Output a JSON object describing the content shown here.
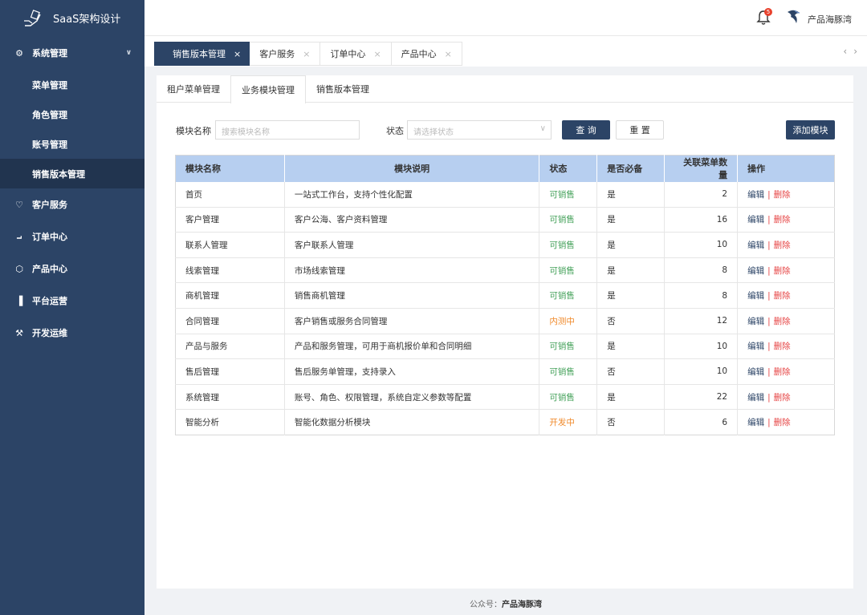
{
  "app": {
    "title": "SaaS架构设计"
  },
  "sidebar": {
    "groups": [
      {
        "label": "系统管理",
        "icon": "gear-icon",
        "expanded": true,
        "children": [
          {
            "label": "菜单管理"
          },
          {
            "label": "角色管理"
          },
          {
            "label": "账号管理"
          },
          {
            "label": "销售版本管理",
            "active": true
          }
        ]
      },
      {
        "label": "客户服务",
        "icon": "heart-icon"
      },
      {
        "label": "订单中心",
        "icon": "cart-icon"
      },
      {
        "label": "产品中心",
        "icon": "cube-icon"
      },
      {
        "label": "平台运营",
        "icon": "bar-chart-icon"
      },
      {
        "label": "开发运维",
        "icon": "wrench-icon"
      }
    ]
  },
  "header": {
    "notification_count": "5",
    "user_name": "产品海豚湾"
  },
  "tabs": [
    {
      "label": "销售版本管理",
      "active": true
    },
    {
      "label": "客户服务"
    },
    {
      "label": "订单中心"
    },
    {
      "label": "产品中心"
    }
  ],
  "subtabs": [
    {
      "label": "租户菜单管理"
    },
    {
      "label": "业务模块管理",
      "active": true
    },
    {
      "label": "销售版本管理"
    }
  ],
  "filter": {
    "name_label": "模块名称",
    "name_placeholder": "搜索模块名称",
    "status_label": "状态",
    "status_placeholder": "请选择状态",
    "query_button": "查 询",
    "reset_button": "重 置",
    "add_button": "添加模块"
  },
  "table": {
    "headers": [
      "模块名称",
      "模块说明",
      "状态",
      "是否必备",
      "关联菜单数量",
      "操作"
    ],
    "edit_label": "编辑",
    "delete_label": "删除",
    "separator": "|",
    "rows": [
      {
        "name": "首页",
        "desc": "一站式工作台，支持个性化配置",
        "status": "可销售",
        "status_color": "#44a15a",
        "required": "是",
        "menu_count": "2"
      },
      {
        "name": "客户管理",
        "desc": "客户公海、客户资料管理",
        "status": "可销售",
        "status_color": "#44a15a",
        "required": "是",
        "menu_count": "16"
      },
      {
        "name": "联系人管理",
        "desc": "客户联系人管理",
        "status": "可销售",
        "status_color": "#44a15a",
        "required": "是",
        "menu_count": "10"
      },
      {
        "name": "线索管理",
        "desc": "市场线索管理",
        "status": "可销售",
        "status_color": "#44a15a",
        "required": "是",
        "menu_count": "8"
      },
      {
        "name": "商机管理",
        "desc": "销售商机管理",
        "status": "可销售",
        "status_color": "#44a15a",
        "required": "是",
        "menu_count": "8"
      },
      {
        "name": "合同管理",
        "desc": "客户销售或服务合同管理",
        "status": "内测中",
        "status_color": "#f08a2b",
        "required": "否",
        "menu_count": "12"
      },
      {
        "name": "产品与服务",
        "desc": "产品和服务管理，可用于商机报价单和合同明细",
        "status": "可销售",
        "status_color": "#44a15a",
        "required": "是",
        "menu_count": "10"
      },
      {
        "name": "售后管理",
        "desc": "售后服务单管理，支持录入",
        "status": "可销售",
        "status_color": "#44a15a",
        "required": "否",
        "menu_count": "10"
      },
      {
        "name": "系统管理",
        "desc": "账号、角色、权限管理，系统自定义参数等配置",
        "status": "可销售",
        "status_color": "#44a15a",
        "required": "是",
        "menu_count": "22"
      },
      {
        "name": "智能分析",
        "desc": "智能化数据分析模块",
        "status": "开发中",
        "status_color": "#f08a2b",
        "required": "否",
        "menu_count": "6"
      }
    ]
  },
  "footer": {
    "prefix": "公众号：",
    "name": "产品海豚湾"
  }
}
